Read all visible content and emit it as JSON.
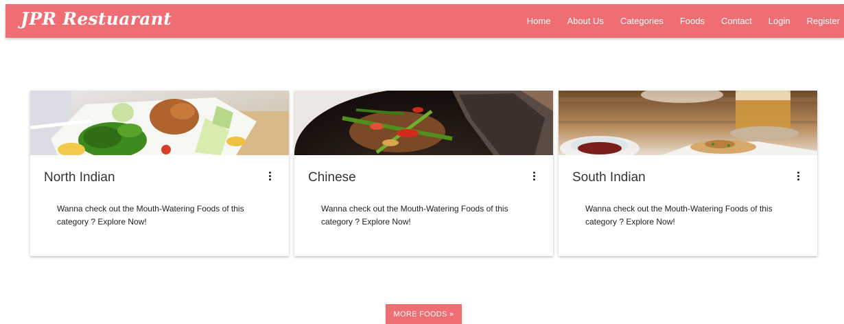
{
  "navbar": {
    "brand": "JPR Restuarant",
    "links": [
      "Home",
      "About Us",
      "Categories",
      "Foods",
      "Contact",
      "Login",
      "Register"
    ]
  },
  "categories": [
    {
      "title": "North Indian",
      "text": "Wanna check out the Mouth-Watering Foods of this category ? Explore Now!",
      "image_icon": "north-indian-food-photo"
    },
    {
      "title": "Chinese",
      "text": "Wanna check out the Mouth-Watering Foods of this category ? Explore Now!",
      "image_icon": "chinese-food-photo"
    },
    {
      "title": "South Indian",
      "text": "Wanna check out the Mouth-Watering Foods of this category ? Explore Now!",
      "image_icon": "south-indian-food-photo"
    }
  ],
  "more_button": "MORE FOODS »",
  "colors": {
    "accent": "#ee6e73",
    "text": "#333333"
  }
}
